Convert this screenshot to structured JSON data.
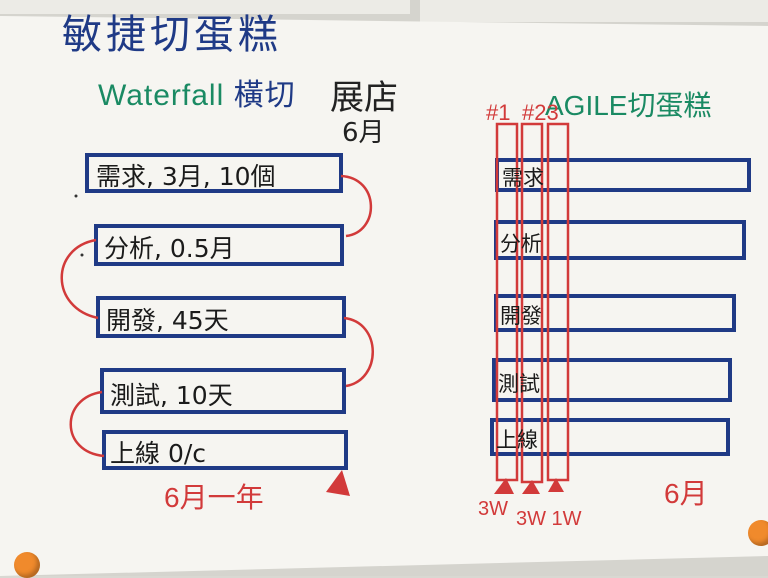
{
  "title": "敏捷切蛋糕",
  "left": {
    "subtitle_latin": "Waterfall",
    "subtitle_cjk": " 橫切",
    "subtitle_tail": "展店",
    "month_note": "6月",
    "bar_labels": [
      "需求, 3月, 10個",
      "分析, 0.5月",
      "開發, 45天",
      "測試, 10天",
      "上線 0/c"
    ],
    "footer": "6月一年"
  },
  "right": {
    "subtitle": "AGILE切蛋糕",
    "iter_label_1": "#1",
    "iter_label_2": "#23",
    "bar_labels": [
      "需求",
      "分析",
      "開發",
      "測試",
      "上線"
    ],
    "footer_a": "3W",
    "footer_b": "3W 1W",
    "footer_month": "6月"
  },
  "colors": {
    "paper": "#f6f5f1",
    "blue_ink": "#1f3a86",
    "green_ink": "#1a8a63",
    "red_ink": "#d23a3a",
    "pin": "#f08a2c"
  }
}
